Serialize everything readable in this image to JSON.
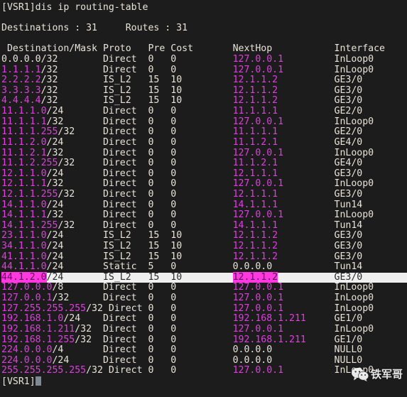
{
  "terminal": {
    "prompt": "[VSR1]",
    "command": "dis ip routing-table",
    "summary": {
      "destinations_label": "Destinations :",
      "destinations_value": "31",
      "routes_label": "Routes :",
      "routes_value": "31"
    },
    "final_prompt": "[VSR1]",
    "colors": {
      "background": "#1c1c1c",
      "foreground": "#e8e3d8",
      "ip_magenta": "#e838e8",
      "highlight_row_bg": "#efefef",
      "match_bg": "#ff38e0",
      "cursor": "#7d8a94"
    }
  },
  "table": {
    "headers": {
      "destination": "Destination/Mask",
      "proto": "Proto",
      "pre": "Pre",
      "cost": "Cost",
      "nexthop": "NextHop",
      "interface": "Interface"
    },
    "rows": [
      {
        "ip": "0.0.0.0",
        "mask": "/32",
        "ip_plain": true,
        "proto": "Direct",
        "pre": "0",
        "cost": "0",
        "nexthop": "127.0.0.1",
        "nexthop_plain": false,
        "interface": "InLoop0"
      },
      {
        "ip": "1.1.1.1",
        "mask": "/32",
        "ip_plain": false,
        "proto": "Direct",
        "pre": "0",
        "cost": "0",
        "nexthop": "127.0.0.1",
        "nexthop_plain": false,
        "interface": "InLoop0"
      },
      {
        "ip": "2.2.2.2",
        "mask": "/32",
        "ip_plain": false,
        "proto": "IS_L2",
        "pre": "15",
        "cost": "10",
        "nexthop": "12.1.1.2",
        "nexthop_plain": false,
        "interface": "GE3/0"
      },
      {
        "ip": "3.3.3.3",
        "mask": "/32",
        "ip_plain": false,
        "proto": "IS_L2",
        "pre": "15",
        "cost": "10",
        "nexthop": "12.1.1.2",
        "nexthop_plain": false,
        "interface": "GE3/0"
      },
      {
        "ip": "4.4.4.4",
        "mask": "/32",
        "ip_plain": false,
        "proto": "IS_L2",
        "pre": "15",
        "cost": "10",
        "nexthop": "12.1.1.2",
        "nexthop_plain": false,
        "interface": "GE3/0"
      },
      {
        "ip": "11.1.1.0",
        "mask": "/24",
        "ip_plain": false,
        "proto": "Direct",
        "pre": "0",
        "cost": "0",
        "nexthop": "11.1.1.1",
        "nexthop_plain": false,
        "interface": "GE2/0"
      },
      {
        "ip": "11.1.1.1",
        "mask": "/32",
        "ip_plain": false,
        "proto": "Direct",
        "pre": "0",
        "cost": "0",
        "nexthop": "127.0.0.1",
        "nexthop_plain": false,
        "interface": "InLoop0"
      },
      {
        "ip": "11.1.1.255",
        "mask": "/32",
        "ip_plain": false,
        "proto": "Direct",
        "pre": "0",
        "cost": "0",
        "nexthop": "11.1.1.1",
        "nexthop_plain": false,
        "interface": "GE2/0"
      },
      {
        "ip": "11.1.2.0",
        "mask": "/24",
        "ip_plain": false,
        "proto": "Direct",
        "pre": "0",
        "cost": "0",
        "nexthop": "11.1.2.1",
        "nexthop_plain": false,
        "interface": "GE4/0"
      },
      {
        "ip": "11.1.2.1",
        "mask": "/32",
        "ip_plain": false,
        "proto": "Direct",
        "pre": "0",
        "cost": "0",
        "nexthop": "127.0.0.1",
        "nexthop_plain": false,
        "interface": "InLoop0"
      },
      {
        "ip": "11.1.2.255",
        "mask": "/32",
        "ip_plain": false,
        "proto": "Direct",
        "pre": "0",
        "cost": "0",
        "nexthop": "11.1.2.1",
        "nexthop_plain": false,
        "interface": "GE4/0"
      },
      {
        "ip": "12.1.1.0",
        "mask": "/24",
        "ip_plain": false,
        "proto": "Direct",
        "pre": "0",
        "cost": "0",
        "nexthop": "12.1.1.1",
        "nexthop_plain": false,
        "interface": "GE3/0"
      },
      {
        "ip": "12.1.1.1",
        "mask": "/32",
        "ip_plain": false,
        "proto": "Direct",
        "pre": "0",
        "cost": "0",
        "nexthop": "127.0.0.1",
        "nexthop_plain": false,
        "interface": "InLoop0"
      },
      {
        "ip": "12.1.1.255",
        "mask": "/32",
        "ip_plain": false,
        "proto": "Direct",
        "pre": "0",
        "cost": "0",
        "nexthop": "12.1.1.1",
        "nexthop_plain": false,
        "interface": "GE3/0"
      },
      {
        "ip": "14.1.1.0",
        "mask": "/24",
        "ip_plain": false,
        "proto": "Direct",
        "pre": "0",
        "cost": "0",
        "nexthop": "14.1.1.1",
        "nexthop_plain": false,
        "interface": "Tun14"
      },
      {
        "ip": "14.1.1.1",
        "mask": "/32",
        "ip_plain": false,
        "proto": "Direct",
        "pre": "0",
        "cost": "0",
        "nexthop": "127.0.0.1",
        "nexthop_plain": false,
        "interface": "InLoop0"
      },
      {
        "ip": "14.1.1.255",
        "mask": "/32",
        "ip_plain": false,
        "proto": "Direct",
        "pre": "0",
        "cost": "0",
        "nexthop": "14.1.1.1",
        "nexthop_plain": false,
        "interface": "Tun14"
      },
      {
        "ip": "23.1.1.0",
        "mask": "/24",
        "ip_plain": false,
        "proto": "IS_L2",
        "pre": "15",
        "cost": "10",
        "nexthop": "12.1.1.2",
        "nexthop_plain": false,
        "interface": "GE3/0"
      },
      {
        "ip": "34.1.1.0",
        "mask": "/24",
        "ip_plain": false,
        "proto": "IS_L2",
        "pre": "15",
        "cost": "10",
        "nexthop": "12.1.1.2",
        "nexthop_plain": false,
        "interface": "GE3/0"
      },
      {
        "ip": "41.1.1.0",
        "mask": "/24",
        "ip_plain": false,
        "proto": "IS_L2",
        "pre": "15",
        "cost": "10",
        "nexthop": "12.1.1.2",
        "nexthop_plain": false,
        "interface": "GE3/0"
      },
      {
        "ip": "44.1.1.0",
        "mask": "/24",
        "ip_plain": false,
        "proto": "Static",
        "pre": "5",
        "cost": "0",
        "nexthop": "0.0.0.0",
        "nexthop_plain": true,
        "interface": "Tun14"
      },
      {
        "ip": "44.1.2.0",
        "mask": "/24",
        "ip_plain": false,
        "proto": "IS_L2",
        "pre": "15",
        "cost": "10",
        "nexthop": "12.1.1.2",
        "nexthop_plain": false,
        "interface": "GE3/0",
        "highlighted": true,
        "match_ip": true,
        "match_nexthop": true
      },
      {
        "ip": "127.0.0.0",
        "mask": "/8",
        "ip_plain": false,
        "proto": "Direct",
        "pre": "0",
        "cost": "0",
        "nexthop": "127.0.0.1",
        "nexthop_plain": false,
        "interface": "InLoop0"
      },
      {
        "ip": "127.0.0.1",
        "mask": "/32",
        "ip_plain": false,
        "proto": "Direct",
        "pre": "0",
        "cost": "0",
        "nexthop": "127.0.0.1",
        "nexthop_plain": false,
        "interface": "InLoop0"
      },
      {
        "ip": "127.255.255.255",
        "mask": "/32",
        "ip_plain": false,
        "proto": "Direct",
        "pre": "0",
        "cost": "0",
        "nexthop": "127.0.0.1",
        "nexthop_plain": false,
        "interface": "InLoop0"
      },
      {
        "ip": "192.168.1.0",
        "mask": "/24",
        "ip_plain": false,
        "proto": "Direct",
        "pre": "0",
        "cost": "0",
        "nexthop": "192.168.1.211",
        "nexthop_plain": false,
        "interface": "GE1/0"
      },
      {
        "ip": "192.168.1.211",
        "mask": "/32",
        "ip_plain": false,
        "proto": "Direct",
        "pre": "0",
        "cost": "0",
        "nexthop": "127.0.0.1",
        "nexthop_plain": false,
        "interface": "InLoop0"
      },
      {
        "ip": "192.168.1.255",
        "mask": "/32",
        "ip_plain": false,
        "proto": "Direct",
        "pre": "0",
        "cost": "0",
        "nexthop": "192.168.1.211",
        "nexthop_plain": false,
        "interface": "GE1/0"
      },
      {
        "ip": "224.0.0.0",
        "mask": "/4",
        "ip_plain": false,
        "proto": "Direct",
        "pre": "0",
        "cost": "0",
        "nexthop": "0.0.0.0",
        "nexthop_plain": true,
        "interface": "NULL0"
      },
      {
        "ip": "224.0.0.0",
        "mask": "/24",
        "ip_plain": false,
        "proto": "Direct",
        "pre": "0",
        "cost": "0",
        "nexthop": "0.0.0.0",
        "nexthop_plain": true,
        "interface": "NULL0"
      },
      {
        "ip": "255.255.255.255",
        "mask": "/32",
        "ip_plain": false,
        "proto": "Direct",
        "pre": "0",
        "cost": "0",
        "nexthop": "127.0.0.1",
        "nexthop_plain": false,
        "interface": "InLoop0"
      }
    ]
  },
  "watermark": {
    "icon": "wechat-icon",
    "text": "铁军哥"
  }
}
